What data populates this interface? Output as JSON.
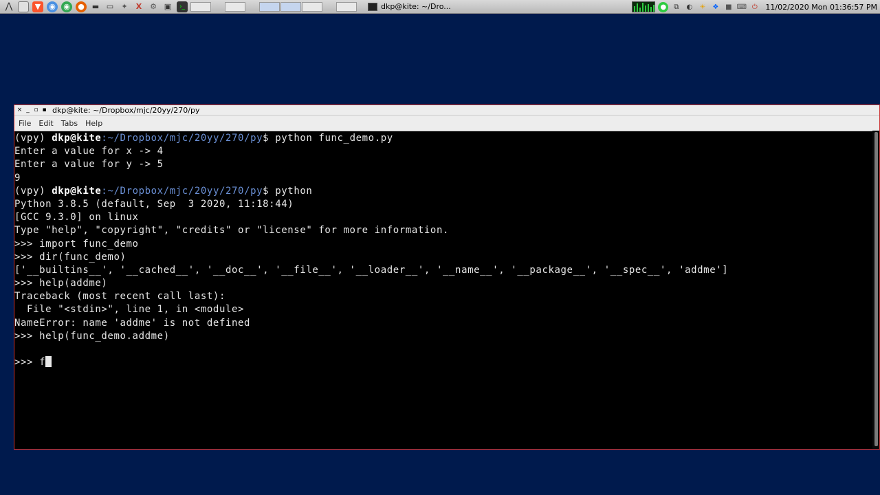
{
  "taskbar": {
    "window_title": "dkp@kite: ~/Dro...",
    "clock": "11/02/2020 Mon 01:36:57 PM"
  },
  "colors": {
    "desktop": "#001a4d",
    "window_border": "#cc3333",
    "terminal_bg": "#000000",
    "terminal_fg": "#e6e6e6",
    "prompt_path": "#6a8fd4"
  },
  "window": {
    "close": "×",
    "minimize": "_",
    "maximize": "▫",
    "menu_glyph": "▪",
    "title": "dkp@kite: ~/Dropbox/mjc/20yy/270/py"
  },
  "menu": {
    "file": "File",
    "edit": "Edit",
    "tabs": "Tabs",
    "help": "Help"
  },
  "terminal": {
    "prompt1_env": "(vpy) ",
    "prompt1_user": "dkp@kite",
    "prompt1_path": ":~/Dropbox/mjc/20yy/270/py",
    "prompt1_cmd": "$ python func_demo.py",
    "line2": "Enter a value for x -> 4",
    "line3": "Enter a value for y -> 5",
    "line4": "9",
    "prompt2_env": "(vpy) ",
    "prompt2_user": "dkp@kite",
    "prompt2_path": ":~/Dropbox/mjc/20yy/270/py",
    "prompt2_cmd": "$ python",
    "line6": "Python 3.8.5 (default, Sep  3 2020, 11:18:44)",
    "line7": "[GCC 9.3.0] on linux",
    "line8": "Type \"help\", \"copyright\", \"credits\" or \"license\" for more information.",
    "line9": ">>> import func_demo",
    "line10": ">>> dir(func_demo)",
    "line11": "['__builtins__', '__cached__', '__doc__', '__file__', '__loader__', '__name__', '__package__', '__spec__', 'addme']",
    "line12": ">>> help(addme)",
    "line13": "Traceback (most recent call last):",
    "line14": "  File \"<stdin>\", line 1, in <module>",
    "line15": "NameError: name 'addme' is not defined",
    "line16": ">>> help(func_demo.addme)",
    "line17": "",
    "line18": ">>> f"
  }
}
